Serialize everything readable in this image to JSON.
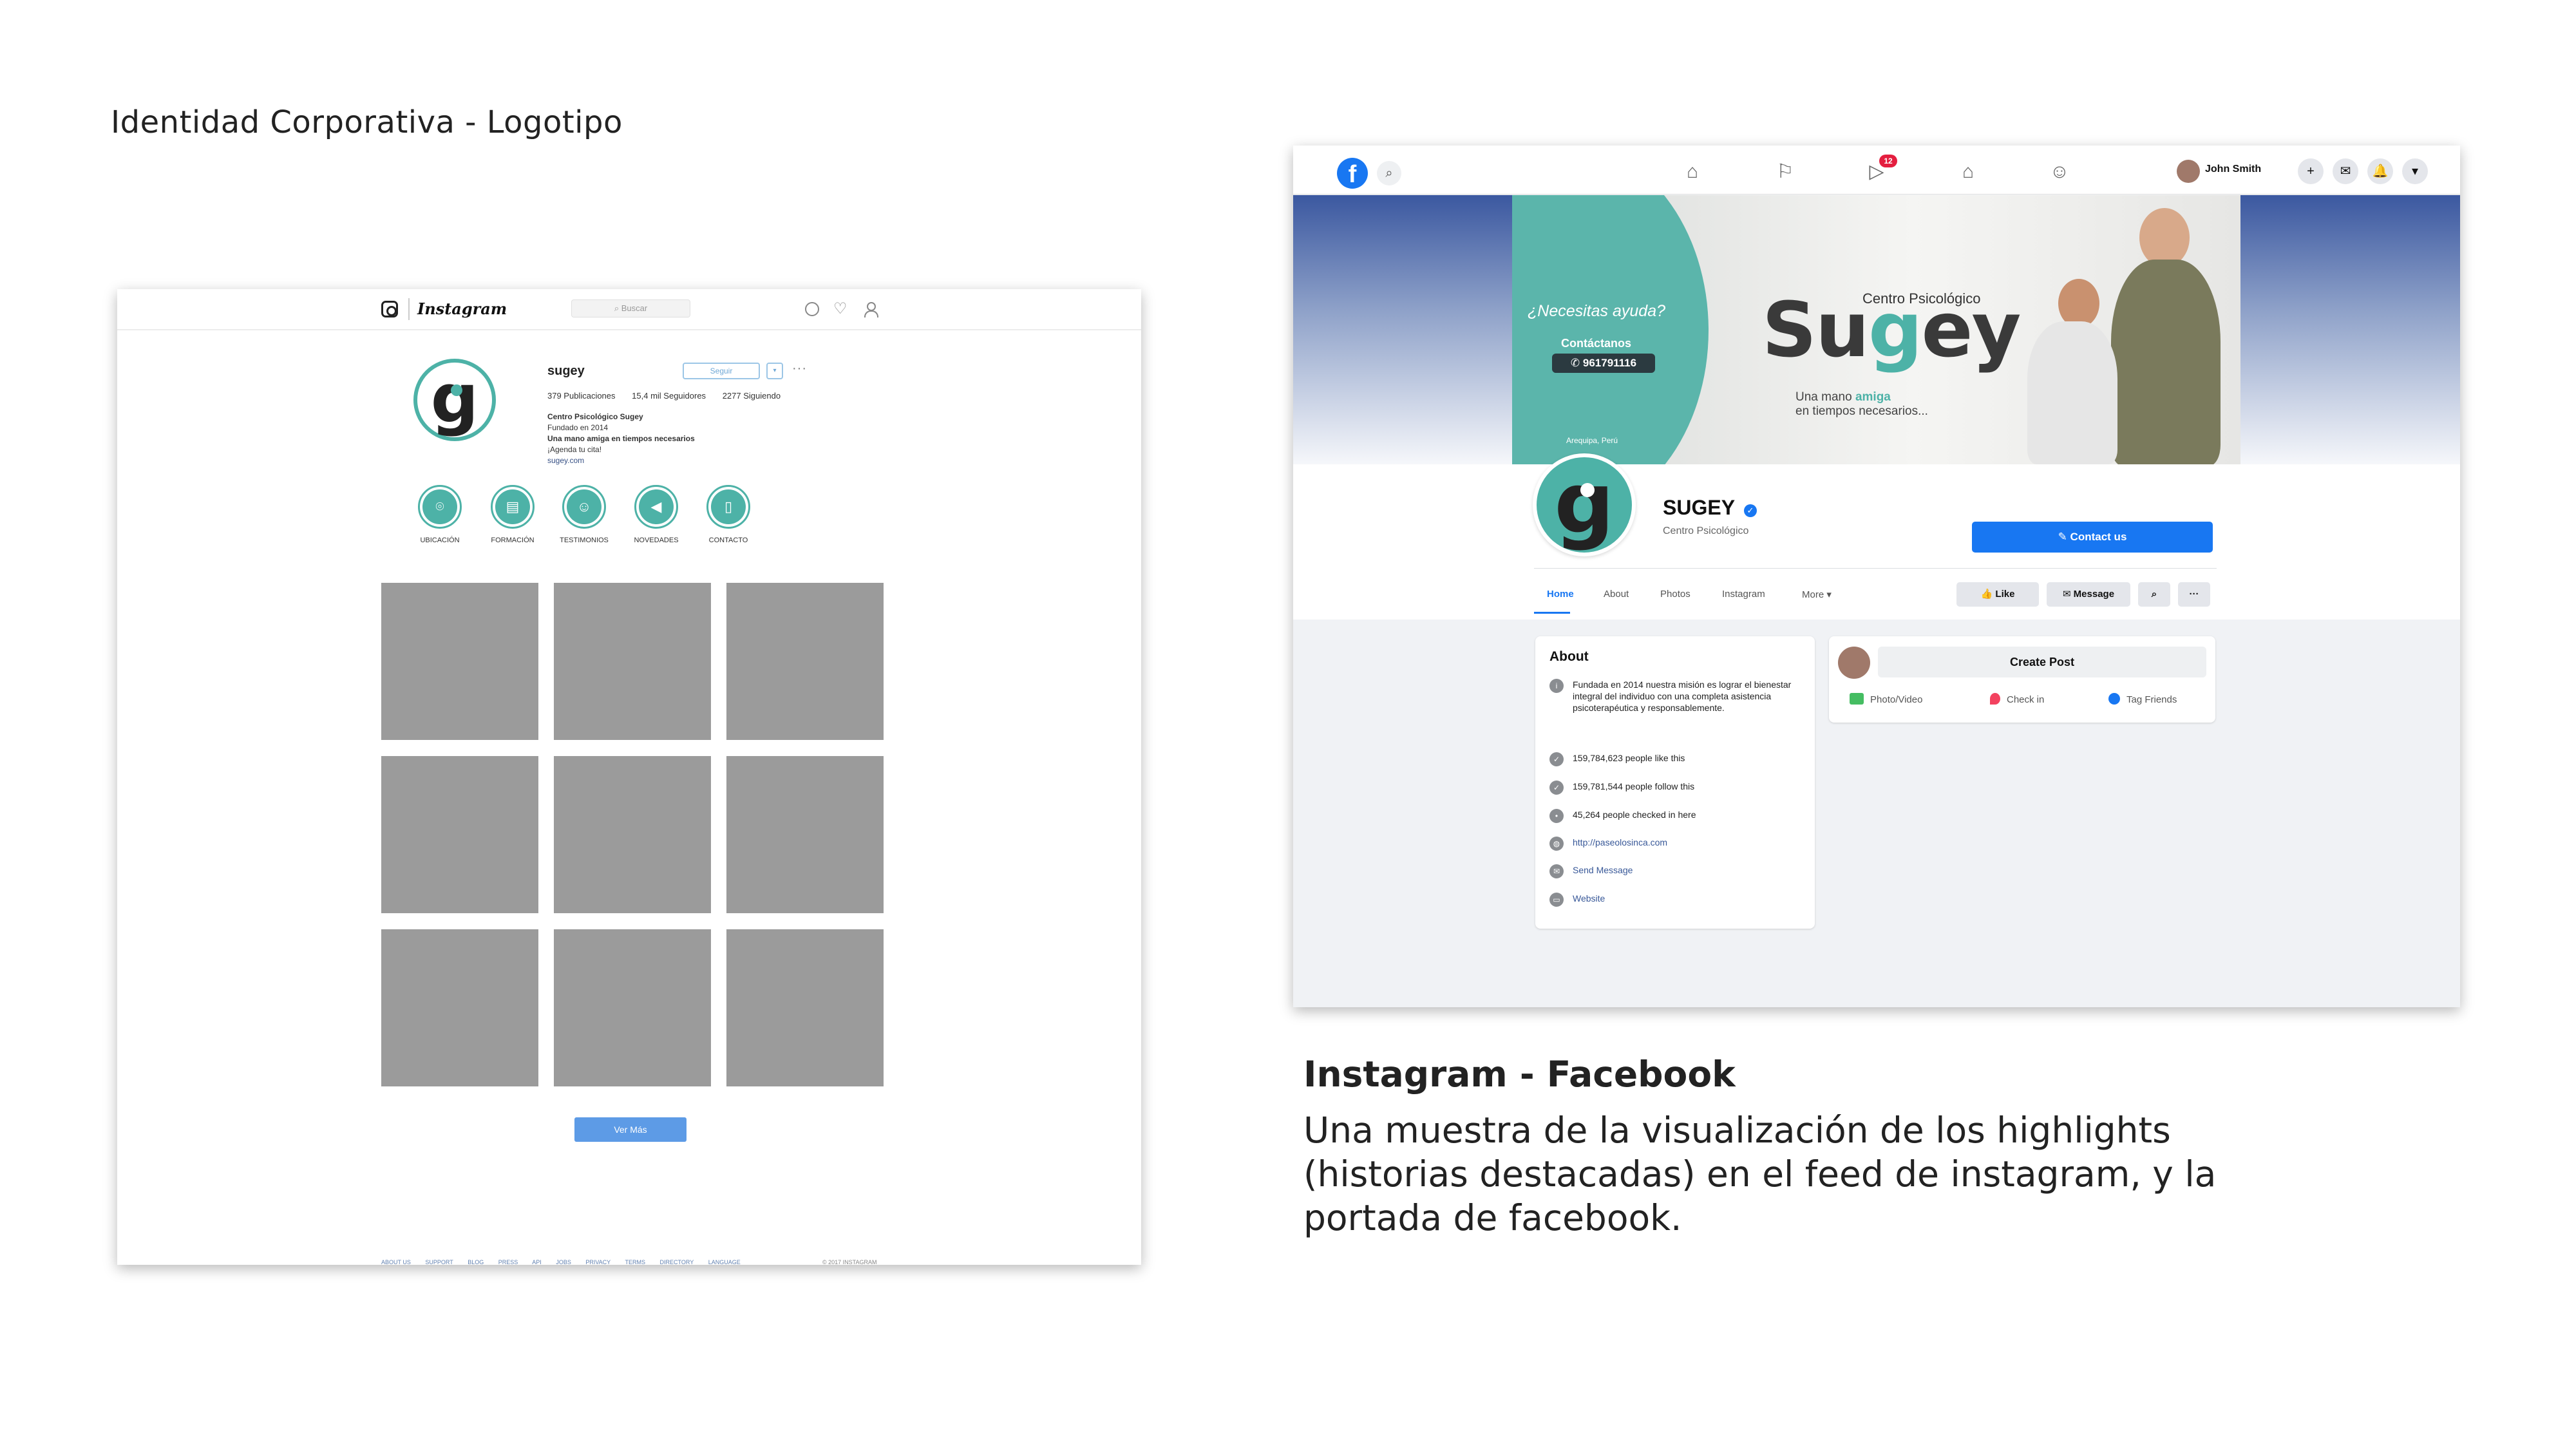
{
  "slide": {
    "heading": "Identidad Corporativa - Logotipo",
    "caption_title": "Instagram - Facebook",
    "caption_body": "Una muestra de la visualización de los highlights (historias destacadas) en el feed de instagram, y la portada de facebook."
  },
  "colors": {
    "brand_teal": "#4db2a7",
    "fb_blue": "#1877f2",
    "ig_placeholder": "#9b9b9b",
    "ig_button": "#5d9be6"
  },
  "instagram": {
    "wordmark": "Instagram",
    "search_placeholder": "Buscar",
    "username": "sugey",
    "follow_label": "Seguir",
    "dropdown_label": "▾",
    "more_label": "···",
    "stats": {
      "posts": "379 Publicaciones",
      "followers": "15,4 mil Seguidores",
      "following": "2277 Siguiendo"
    },
    "bio": {
      "name": "Centro Psicológico Sugey",
      "line1": "Fundado en 2014",
      "line2": "Una mano amiga en tiempos necesarios",
      "line3": "¡Agenda tu cita!",
      "link": "sugey.com"
    },
    "highlights": [
      {
        "label": "UBICACIÓN",
        "icon": "location-pin-icon",
        "glyph": "⌾"
      },
      {
        "label": "FORMACIÓN",
        "icon": "document-icon",
        "glyph": "▤"
      },
      {
        "label": "TESTIMONIOS",
        "icon": "people-icon",
        "glyph": "☺"
      },
      {
        "label": "NOVEDADES",
        "icon": "megaphone-icon",
        "glyph": "◀"
      },
      {
        "label": "CONTACTO",
        "icon": "phone-icon",
        "glyph": "▯"
      }
    ],
    "see_more_label": "Ver Más",
    "footer_links": [
      "ABOUT US",
      "SUPPORT",
      "BLOG",
      "PRESS",
      "API",
      "JOBS",
      "PRIVACY",
      "TERMS",
      "DIRECTORY",
      "LANGUAGE"
    ],
    "copyright": "© 2017 INSTAGRAM"
  },
  "facebook": {
    "logo_glyph": "f",
    "search_glyph": "⌕",
    "nav_icons": [
      {
        "name": "home-icon",
        "glyph": "⌂"
      },
      {
        "name": "flag-icon",
        "glyph": "⚐"
      },
      {
        "name": "watch-icon",
        "glyph": "▷"
      },
      {
        "name": "marketplace-icon",
        "glyph": "⌂"
      },
      {
        "name": "groups-icon",
        "glyph": "☺"
      }
    ],
    "watch_badge": "12",
    "user_name": "John Smith",
    "header_buttons": [
      {
        "name": "create-icon",
        "glyph": "+"
      },
      {
        "name": "messenger-icon",
        "glyph": "✉"
      },
      {
        "name": "notifications-icon",
        "glyph": "🔔"
      },
      {
        "name": "account-menu-icon",
        "glyph": "▾"
      }
    ],
    "cover": {
      "question": "¿Necesitas ayuda?",
      "contact_label": "Contáctanos",
      "phone": "✆ 961791116",
      "city": "Arequipa, Perú",
      "center_label": "Centro Psicológico",
      "brand_start": "Su",
      "brand_mid": "g",
      "brand_end": "ey",
      "tagline_prefix": "Una mano",
      "tagline_highlight": "amiga",
      "tagline_line2": "en tiempos necesarios..."
    },
    "page_name": "SUGEY",
    "verified_glyph": "✓",
    "page_category": "Centro Psicológico",
    "contact_button": "✎ Contact us",
    "tabs": [
      "Home",
      "About",
      "Photos",
      "Instagram",
      "More ▾"
    ],
    "action_buttons": {
      "like": "👍 Like",
      "message": "✉ Message",
      "search": "⌕",
      "more": "···"
    },
    "about": {
      "title": "About",
      "rows": [
        {
          "icon": "info-icon",
          "glyph": "i",
          "text": "Fundada en 2014 nuestra misión es lograr el bienestar integral del individuo con una completa asistencia psicoterapéutica y responsablemente."
        },
        {
          "icon": "like-icon",
          "glyph": "✓",
          "text": "159,784,623 people like this"
        },
        {
          "icon": "follow-icon",
          "glyph": "✓",
          "text": "159,781,544 people follow this"
        },
        {
          "icon": "checkin-icon",
          "glyph": "•",
          "text": "45,264 people checked in here"
        },
        {
          "icon": "globe-icon",
          "glyph": "◍",
          "text": "http://paseolosinca.com"
        },
        {
          "icon": "messenger-icon",
          "glyph": "✉",
          "text": "Send Message"
        },
        {
          "icon": "website-icon",
          "glyph": "▭",
          "text": "Website"
        }
      ]
    },
    "create_post": {
      "button": "Create Post",
      "photo_video": "Photo/Video",
      "check_in": "Check in",
      "tag_friends": "Tag Friends"
    }
  }
}
